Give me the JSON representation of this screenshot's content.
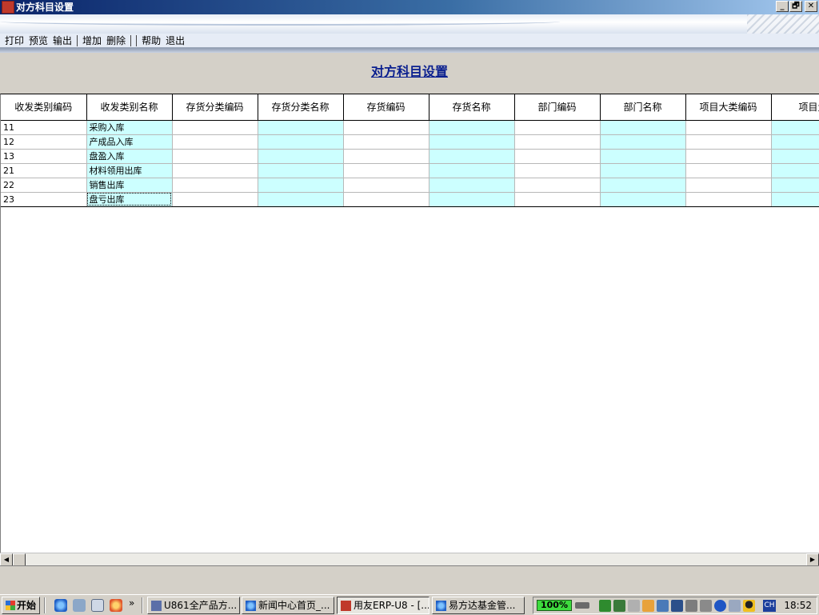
{
  "window": {
    "title": "对方科目设置",
    "min": "_",
    "max": "🗗",
    "close": "✕"
  },
  "menu": [
    "打印",
    "预览",
    "输出",
    "增加",
    "删除",
    "帮助",
    "退出"
  ],
  "page_title": "对方科目设置",
  "table": {
    "columns": [
      "收发类别编码",
      "收发类别名称",
      "存货分类编码",
      "存货分类名称",
      "存货编码",
      "存货名称",
      "部门编码",
      "部门名称",
      "项目大类编码",
      "项目大类"
    ],
    "rows": [
      [
        "11",
        "采购入库"
      ],
      [
        "12",
        "产成品入库"
      ],
      [
        "13",
        "盘盈入库"
      ],
      [
        "21",
        "材料领用出库"
      ],
      [
        "22",
        "销售出库"
      ],
      [
        "23",
        "盘亏出库"
      ]
    ],
    "cyan_column_color": "#ccffff"
  },
  "taskbar": {
    "start": "开始",
    "quicklaunch_more": "»",
    "tasks": [
      "U861全产品方...",
      "新闻中心首页_...",
      "用友ERP-U8 - [...",
      "易方达基金管..."
    ],
    "battery": "100%",
    "lang": "CH",
    "clock": "18:52"
  },
  "colors": {
    "title_bar": "#0a246a",
    "heading": "#0a1f8f",
    "battery": "#3ddc3d"
  }
}
